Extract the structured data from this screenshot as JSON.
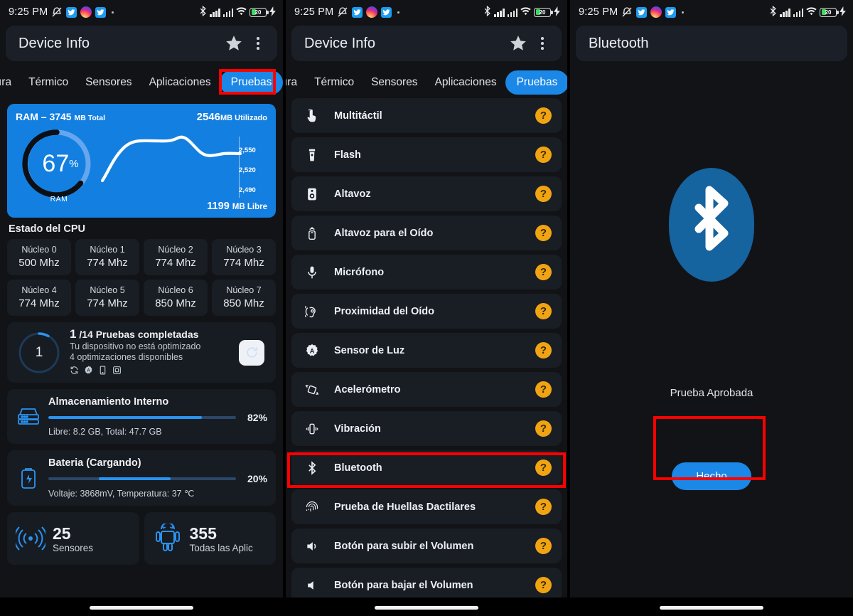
{
  "status_bar": {
    "time": "9:25 PM",
    "icons_left": [
      "bell-muted-icon",
      "twitter-icon",
      "instagram-icon",
      "twitter-icon",
      "dot-icon"
    ],
    "icons_right": [
      "bluetooth-icon",
      "signal-bars-icon",
      "signal-bars-icon",
      "wifi-icon",
      "battery-icon",
      "charging-bolt-icon"
    ],
    "battery_level": "20"
  },
  "screen1": {
    "appbar": {
      "title": "Device Info",
      "star": "star-icon",
      "menu": "kebab-menu-icon"
    },
    "tabs": [
      {
        "label": "ıra",
        "active": false
      },
      {
        "label": "Térmico",
        "active": false
      },
      {
        "label": "Sensores",
        "active": false
      },
      {
        "label": "Aplicaciones",
        "active": false
      },
      {
        "label": "Pruebas",
        "active": true
      }
    ],
    "ram_card": {
      "title": "RAM – 3745",
      "title_unit": "MB Total",
      "used_value": "2546",
      "used_unit": "MB Utilizado",
      "percent": "67",
      "percent_symbol": "%",
      "gauge_label": "RAM",
      "yticks": [
        "2,550",
        "2,520",
        "2,490"
      ],
      "free_value": "1199",
      "free_unit": "MB Libre"
    },
    "cpu_heading": "Estado del CPU",
    "cores": [
      {
        "name": "Núcleo 0",
        "freq": "500 Mhz"
      },
      {
        "name": "Núcleo 1",
        "freq": "774 Mhz"
      },
      {
        "name": "Núcleo 2",
        "freq": "774 Mhz"
      },
      {
        "name": "Núcleo 3",
        "freq": "774 Mhz"
      },
      {
        "name": "Núcleo 4",
        "freq": "774 Mhz"
      },
      {
        "name": "Núcleo 5",
        "freq": "774 Mhz"
      },
      {
        "name": "Núcleo 6",
        "freq": "850 Mhz"
      },
      {
        "name": "Núcleo 7",
        "freq": "850 Mhz"
      }
    ],
    "tests_summary": {
      "ring_value": "1",
      "count": "1",
      "headline_rest": "/14 Pruebas completadas",
      "line1": "Tu dispositivo no está optimizado",
      "line2": "4 optimizaciones disponibles",
      "mini_icons": [
        "sync-icon",
        "auto-badge-icon",
        "phone-icon",
        "boxed-square-icon"
      ],
      "refresh_icon": "refresh-icon"
    },
    "storage": {
      "icon": "storage-drive-icon",
      "title": "Almacenamiento Interno",
      "percent": "82%",
      "fill": 82,
      "sub": "Libre: 8.2 GB,  Total: 47.7 GB"
    },
    "battery": {
      "icon": "battery-charging-icon",
      "title": "Bateria (Cargando)",
      "percent": "20%",
      "fill": 20,
      "fill_offset": 27,
      "sub": "Voltaje: 3868mV,  Temperatura: 37 ℃"
    },
    "stats": [
      {
        "icon": "sensor-waves-icon",
        "value": "25",
        "label": "Sensores"
      },
      {
        "icon": "android-robot-icon",
        "value": "355",
        "label": "Todas las Aplic"
      }
    ],
    "highlight": "Pruebas"
  },
  "screen2": {
    "appbar": {
      "title": "Device Info",
      "star": "star-icon",
      "menu": "kebab-menu-icon"
    },
    "tabs": [
      {
        "label": "ıra",
        "active": false
      },
      {
        "label": "Térmico",
        "active": false
      },
      {
        "label": "Sensores",
        "active": false
      },
      {
        "label": "Aplicaciones",
        "active": false
      },
      {
        "label": "Pruebas",
        "active": true
      }
    ],
    "badge": "?",
    "tests": [
      {
        "icon": "multitouch-icon",
        "label": "Multitáctil"
      },
      {
        "icon": "flashlight-icon",
        "label": "Flash"
      },
      {
        "icon": "speaker-icon",
        "label": "Altavoz"
      },
      {
        "icon": "earpiece-speaker-icon",
        "label": "Altavoz para el Oído"
      },
      {
        "icon": "microphone-icon",
        "label": "Micrófono"
      },
      {
        "icon": "proximity-ear-icon",
        "label": "Proximidad del Oído"
      },
      {
        "icon": "light-sensor-icon",
        "label": "Sensor de Luz"
      },
      {
        "icon": "accelerometer-icon",
        "label": "Acelerómetro"
      },
      {
        "icon": "vibration-icon",
        "label": "Vibración"
      },
      {
        "icon": "bluetooth-icon",
        "label": "Bluetooth",
        "highlighted": true
      },
      {
        "icon": "fingerprint-icon",
        "label": "Prueba de Huellas Dactilares"
      },
      {
        "icon": "volume-up-icon",
        "label": "Botón para subir el Volumen"
      },
      {
        "icon": "volume-down-icon",
        "label": "Botón para bajar el Volumen"
      }
    ]
  },
  "screen3": {
    "appbar": {
      "title": "Bluetooth"
    },
    "logo_icon": "bluetooth-logo-icon",
    "result_text": "Prueba Aprobada",
    "done_button": "Hecho"
  },
  "colors": {
    "accent_blue": "#1b87e6",
    "ram_card_blue": "#137fe0",
    "badge_orange": "#f0a413",
    "highlight_red": "#ff0000",
    "panel_bg": "#121316",
    "card_bg": "#191d24"
  }
}
